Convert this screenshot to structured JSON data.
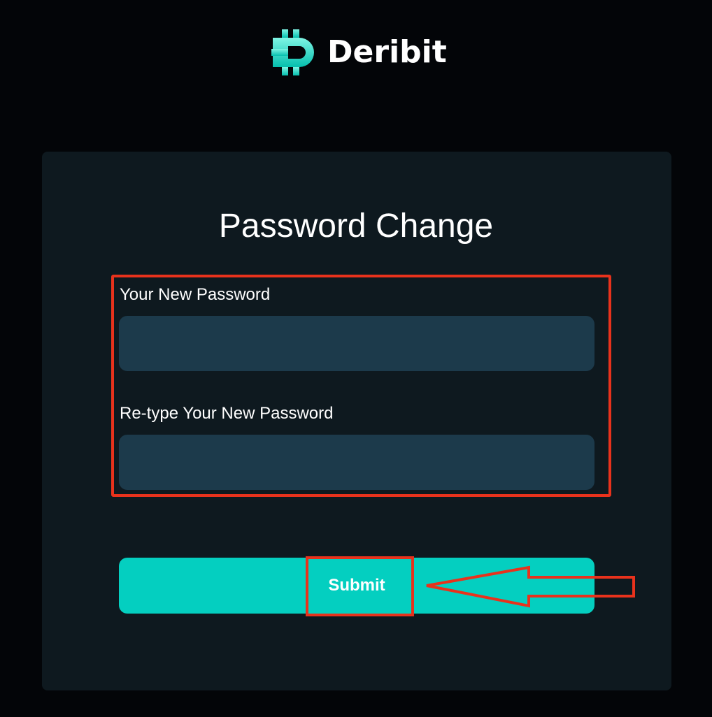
{
  "brand": {
    "name": "Deribit",
    "mark_gradient": [
      "#7ff5e4",
      "#05bfae"
    ]
  },
  "form": {
    "title": "Password Change",
    "new_password_label": "Your New Password",
    "new_password_value": "",
    "retype_password_label": "Re-type Your New Password",
    "retype_password_value": "",
    "submit_label": "Submit"
  },
  "annotations": {
    "color": "#e8321c",
    "items": [
      "fields-highlight-box",
      "submit-highlight-box",
      "arrow-pointer"
    ]
  },
  "colors": {
    "background": "#030508",
    "card": "#0e191f",
    "input": "#1c3a4b",
    "accent": "#04cfc0"
  }
}
